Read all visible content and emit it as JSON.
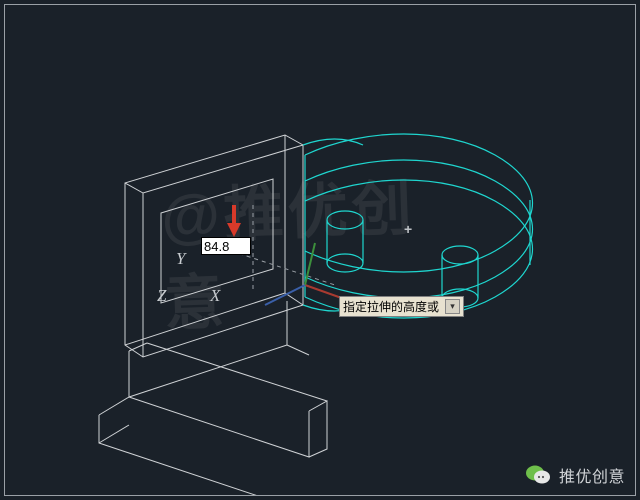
{
  "viewport": {
    "background": "#1a2129",
    "axis_labels": {
      "x": "X",
      "y": "Y",
      "z": "Z"
    }
  },
  "dimension": {
    "input_value": "84.8"
  },
  "tooltip": {
    "text": "指定拉伸的高度或",
    "expand_glyph": "▾"
  },
  "colors": {
    "wireframe_primary": "#cfd2d5",
    "wireframe_highlight": "#1fd6cf",
    "ucs_x": "#a83a30",
    "ucs_y": "#3c8f3c",
    "ucs_z": "#3a5fa8",
    "arrow": "#d83a2a"
  },
  "ucs_origin_marker": "+",
  "watermark": "@推优创意",
  "footer": {
    "brand": "推优创意",
    "icon": "chat-bubble-icon"
  }
}
